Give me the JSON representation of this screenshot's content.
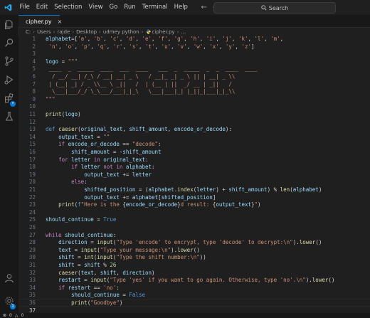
{
  "menu": {
    "items": [
      "File",
      "Edit",
      "Selection",
      "View",
      "Go",
      "Run",
      "Terminal",
      "Help"
    ],
    "back_icon": "arrow-left-icon",
    "forward_icon": "arrow-right-icon"
  },
  "search": {
    "label": "Search"
  },
  "tab": {
    "filename": "cipher.py",
    "close": "×"
  },
  "breadcrumbs": [
    "C:",
    "Users",
    "rajde",
    "Desktop",
    "udmey python",
    "cipher.py",
    "..."
  ],
  "editor": {
    "active_line": 37,
    "lines": [
      {
        "n": 1,
        "t": [
          [
            "var",
            "alphabet"
          ],
          [
            "op",
            "=["
          ],
          [
            "str",
            "'a'"
          ],
          [
            "op",
            ", "
          ],
          [
            "str",
            "'b'"
          ],
          [
            "op",
            ", "
          ],
          [
            "str",
            "'c'"
          ],
          [
            "op",
            ", "
          ],
          [
            "str",
            "'d'"
          ],
          [
            "op",
            ", "
          ],
          [
            "str",
            "'e'"
          ],
          [
            "op",
            ", "
          ],
          [
            "str",
            "'f'"
          ],
          [
            "op",
            ", "
          ],
          [
            "str",
            "'g'"
          ],
          [
            "op",
            ", "
          ],
          [
            "str",
            "'h'"
          ],
          [
            "op",
            ", "
          ],
          [
            "str",
            "'i'"
          ],
          [
            "op",
            ", "
          ],
          [
            "str",
            "'j'"
          ],
          [
            "op",
            ", "
          ],
          [
            "str",
            "'k'"
          ],
          [
            "op",
            ", "
          ],
          [
            "str",
            "'l'"
          ],
          [
            "op",
            ", "
          ],
          [
            "str",
            "'m'"
          ],
          [
            "op",
            ","
          ]
        ]
      },
      {
        "n": 2,
        "t": [
          [
            "op",
            " "
          ],
          [
            "str",
            "'n'"
          ],
          [
            "op",
            ", "
          ],
          [
            "str",
            "'o'"
          ],
          [
            "op",
            ", "
          ],
          [
            "str",
            "'p'"
          ],
          [
            "op",
            ", "
          ],
          [
            "str",
            "'q'"
          ],
          [
            "op",
            ", "
          ],
          [
            "str",
            "'r'"
          ],
          [
            "op",
            ", "
          ],
          [
            "str",
            "'s'"
          ],
          [
            "op",
            ", "
          ],
          [
            "str",
            "'t'"
          ],
          [
            "op",
            ", "
          ],
          [
            "str",
            "'u'"
          ],
          [
            "op",
            ", "
          ],
          [
            "str",
            "'v'"
          ],
          [
            "op",
            ", "
          ],
          [
            "str",
            "'w'"
          ],
          [
            "op",
            ", "
          ],
          [
            "str",
            "'x'"
          ],
          [
            "op",
            ", "
          ],
          [
            "str",
            "'y'"
          ],
          [
            "op",
            ", "
          ],
          [
            "str",
            "'z'"
          ],
          [
            "op",
            "]"
          ]
        ]
      },
      {
        "n": 3,
        "t": []
      },
      {
        "n": 4,
        "t": [
          [
            "var",
            "logo"
          ],
          [
            "op",
            " = "
          ],
          [
            "str",
            "\"\"\""
          ]
        ]
      },
      {
        "n": 5,
        "t": [
          [
            "str",
            " ____  _  _____  ____  ___  ____   ___  _  _____  _  _  ____  ____"
          ]
        ]
      },
      {
        "n": 6,
        "t": [
          [
            "str",
            "  / __/ __| /_\\ / __| __| _ \\   / __|_ _| _ \\ || | __| _ \\\\"
          ]
        ]
      },
      {
        "n": 7,
        "t": [
          [
            "str",
            " | (__| _| / _ \\\\__ \\ _||   /  | (__ | ||  _/ __ | _||   /"
          ]
        ]
      },
      {
        "n": 8,
        "t": [
          [
            "str",
            "  \\___|___/_/ \\_\\___/___|_|_\\   \\___|___|_| |_||_|___|_|_\\\\"
          ]
        ]
      },
      {
        "n": 9,
        "t": [
          [
            "str",
            "\"\"\""
          ]
        ]
      },
      {
        "n": 10,
        "t": []
      },
      {
        "n": 11,
        "t": [
          [
            "fn",
            "print"
          ],
          [
            "op",
            "("
          ],
          [
            "var",
            "logo"
          ],
          [
            "op",
            ")"
          ]
        ]
      },
      {
        "n": 12,
        "t": []
      },
      {
        "n": 13,
        "t": [
          [
            "bool",
            "def "
          ],
          [
            "fn",
            "caeser"
          ],
          [
            "op",
            "("
          ],
          [
            "var",
            "original_text"
          ],
          [
            "op",
            ", "
          ],
          [
            "var",
            "shift_amount"
          ],
          [
            "op",
            ", "
          ],
          [
            "var",
            "encode_or_decode"
          ],
          [
            "op",
            "):"
          ]
        ]
      },
      {
        "n": 14,
        "t": [
          [
            "pl",
            "    "
          ],
          [
            "var",
            "output_text"
          ],
          [
            "op",
            " = "
          ],
          [
            "str",
            "\"\""
          ]
        ]
      },
      {
        "n": 15,
        "t": [
          [
            "pl",
            "    "
          ],
          [
            "kw",
            "if "
          ],
          [
            "var",
            "encode_or_decode"
          ],
          [
            "op",
            " == "
          ],
          [
            "str",
            "\"decode\""
          ],
          [
            "op",
            ":"
          ]
        ]
      },
      {
        "n": 16,
        "t": [
          [
            "pl",
            "        "
          ],
          [
            "var",
            "shift_amount"
          ],
          [
            "op",
            " = -"
          ],
          [
            "var",
            "shift_amount"
          ]
        ]
      },
      {
        "n": 17,
        "t": [
          [
            "pl",
            "    "
          ],
          [
            "kw",
            "for "
          ],
          [
            "var",
            "letter"
          ],
          [
            "kw",
            " in "
          ],
          [
            "var",
            "original_text"
          ],
          [
            "op",
            ":"
          ]
        ]
      },
      {
        "n": 18,
        "t": [
          [
            "pl",
            "        "
          ],
          [
            "kw",
            "if "
          ],
          [
            "var",
            "letter"
          ],
          [
            "kw",
            " not in "
          ],
          [
            "var",
            "alphabet"
          ],
          [
            "op",
            ":"
          ]
        ]
      },
      {
        "n": 19,
        "t": [
          [
            "pl",
            "            "
          ],
          [
            "var",
            "output_text"
          ],
          [
            "op",
            " += "
          ],
          [
            "var",
            "letter"
          ]
        ]
      },
      {
        "n": 20,
        "t": [
          [
            "pl",
            "        "
          ],
          [
            "kw",
            "else"
          ],
          [
            "op",
            ":"
          ]
        ]
      },
      {
        "n": 21,
        "t": [
          [
            "pl",
            "            "
          ],
          [
            "var",
            "shifted_position"
          ],
          [
            "op",
            " = ("
          ],
          [
            "var",
            "alphabet"
          ],
          [
            "op",
            "."
          ],
          [
            "fn",
            "index"
          ],
          [
            "op",
            "("
          ],
          [
            "var",
            "letter"
          ],
          [
            "op",
            ") + "
          ],
          [
            "var",
            "shift_amount"
          ],
          [
            "op",
            ") % "
          ],
          [
            "fn",
            "len"
          ],
          [
            "op",
            "("
          ],
          [
            "var",
            "alphabet"
          ],
          [
            "op",
            ")"
          ]
        ]
      },
      {
        "n": 22,
        "t": [
          [
            "pl",
            "            "
          ],
          [
            "var",
            "output_text"
          ],
          [
            "op",
            " += "
          ],
          [
            "var",
            "alphabet"
          ],
          [
            "op",
            "["
          ],
          [
            "var",
            "shifted_position"
          ],
          [
            "op",
            "]"
          ]
        ]
      },
      {
        "n": 23,
        "t": [
          [
            "pl",
            "    "
          ],
          [
            "fn",
            "print"
          ],
          [
            "op",
            "("
          ],
          [
            "fstr",
            "f"
          ],
          [
            "str",
            "\"Here is the "
          ],
          [
            "op",
            "{"
          ],
          [
            "var",
            "encode_or_decode"
          ],
          [
            "op",
            "}"
          ],
          [
            "str",
            "d result: "
          ],
          [
            "op",
            "{"
          ],
          [
            "var",
            "output_text"
          ],
          [
            "op",
            "}"
          ],
          [
            "str",
            "\""
          ],
          [
            "op",
            ")"
          ]
        ]
      },
      {
        "n": 24,
        "t": []
      },
      {
        "n": 25,
        "t": [
          [
            "var",
            "should_continue"
          ],
          [
            "op",
            " = "
          ],
          [
            "bool",
            "True"
          ]
        ]
      },
      {
        "n": 26,
        "t": []
      },
      {
        "n": 27,
        "t": [
          [
            "kw",
            "while "
          ],
          [
            "var",
            "should_continue"
          ],
          [
            "op",
            ":"
          ]
        ]
      },
      {
        "n": 28,
        "t": [
          [
            "pl",
            "    "
          ],
          [
            "var",
            "direction"
          ],
          [
            "op",
            " = "
          ],
          [
            "fn",
            "input"
          ],
          [
            "op",
            "("
          ],
          [
            "str",
            "\"Type 'encode' to encrypt, type 'decode' to decrypt:\\n\""
          ],
          [
            "op",
            ")."
          ],
          [
            "fn",
            "lower"
          ],
          [
            "op",
            "()"
          ]
        ]
      },
      {
        "n": 29,
        "t": [
          [
            "pl",
            "    "
          ],
          [
            "var",
            "text"
          ],
          [
            "op",
            " = "
          ],
          [
            "fn",
            "input"
          ],
          [
            "op",
            "("
          ],
          [
            "str",
            "\"Type your message:\\n\""
          ],
          [
            "op",
            ")."
          ],
          [
            "fn",
            "lower"
          ],
          [
            "op",
            "()"
          ]
        ]
      },
      {
        "n": 30,
        "t": [
          [
            "pl",
            "    "
          ],
          [
            "var",
            "shift"
          ],
          [
            "op",
            " = "
          ],
          [
            "fn",
            "int"
          ],
          [
            "op",
            "("
          ],
          [
            "fn",
            "input"
          ],
          [
            "op",
            "("
          ],
          [
            "str",
            "\"Type the shift number:\\n\""
          ],
          [
            "op",
            "))"
          ]
        ]
      },
      {
        "n": 31,
        "t": [
          [
            "pl",
            "    "
          ],
          [
            "var",
            "shift"
          ],
          [
            "op",
            " = "
          ],
          [
            "var",
            "shift"
          ],
          [
            "op",
            " % "
          ],
          [
            "num",
            "26"
          ]
        ]
      },
      {
        "n": 32,
        "t": [
          [
            "pl",
            "    "
          ],
          [
            "fn",
            "caeser"
          ],
          [
            "op",
            "("
          ],
          [
            "var",
            "text"
          ],
          [
            "op",
            ", "
          ],
          [
            "var",
            "shift"
          ],
          [
            "op",
            ", "
          ],
          [
            "var",
            "direction"
          ],
          [
            "op",
            ")"
          ]
        ]
      },
      {
        "n": 33,
        "t": [
          [
            "pl",
            "    "
          ],
          [
            "var",
            "restart"
          ],
          [
            "op",
            " = "
          ],
          [
            "fn",
            "input"
          ],
          [
            "op",
            "("
          ],
          [
            "str",
            "\"Type 'yes' if you want to go again. Otherwise, type 'no'.\\n\""
          ],
          [
            "op",
            ")."
          ],
          [
            "fn",
            "lower"
          ],
          [
            "op",
            "()"
          ]
        ]
      },
      {
        "n": 34,
        "t": [
          [
            "pl",
            "    "
          ],
          [
            "kw",
            "if "
          ],
          [
            "var",
            "restart"
          ],
          [
            "op",
            " == "
          ],
          [
            "str",
            "'no'"
          ],
          [
            "op",
            ":"
          ]
        ]
      },
      {
        "n": 35,
        "t": [
          [
            "pl",
            "        "
          ],
          [
            "var",
            "should_continue"
          ],
          [
            "op",
            " = "
          ],
          [
            "bool",
            "False"
          ]
        ]
      },
      {
        "n": 36,
        "t": [
          [
            "pl",
            "        "
          ],
          [
            "fn",
            "print"
          ],
          [
            "op",
            "("
          ],
          [
            "str",
            "\"Goodbye\""
          ],
          [
            "op",
            ")"
          ]
        ]
      },
      {
        "n": 37,
        "t": []
      }
    ]
  },
  "status": {
    "errors": "0",
    "warnings": "0"
  },
  "colors": {
    "accent": "#0078d4",
    "background": "#1f1f1f",
    "string": "#ce9178",
    "keyword": "#c586c0",
    "function": "#dcdcaa",
    "variable": "#9cdcfe"
  }
}
